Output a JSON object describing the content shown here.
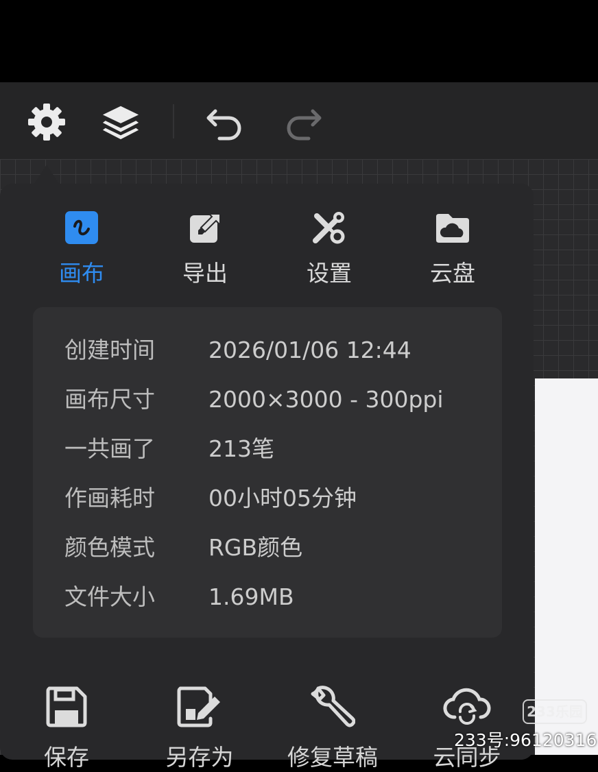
{
  "toolbar": {
    "settings_icon": "gear-icon",
    "layers_icon": "layers-icon",
    "undo_icon": "undo-icon",
    "redo_icon": "redo-icon"
  },
  "tabs": [
    {
      "label": "画布",
      "icon": "canvas-icon",
      "active": true
    },
    {
      "label": "导出",
      "icon": "export-icon",
      "active": false
    },
    {
      "label": "设置",
      "icon": "tools-icon",
      "active": false
    },
    {
      "label": "云盘",
      "icon": "cloud-drive-icon",
      "active": false
    }
  ],
  "info": [
    {
      "key": "创建时间",
      "value": "2026/01/06 12:44"
    },
    {
      "key": "画布尺寸",
      "value": "2000×3000 - 300ppi"
    },
    {
      "key": "一共画了",
      "value": "213笔"
    },
    {
      "key": "作画耗时",
      "value": "00小时05分钟"
    },
    {
      "key": "颜色模式",
      "value": "RGB颜色"
    },
    {
      "key": "文件大小",
      "value": "1.69MB"
    }
  ],
  "actions": [
    {
      "label": "保存",
      "icon": "save-icon"
    },
    {
      "label": "另存为",
      "icon": "save-as-icon"
    },
    {
      "label": "修复草稿",
      "icon": "wrench-icon"
    },
    {
      "label": "云同步",
      "icon": "cloud-sync-icon"
    }
  ],
  "watermark": {
    "logo": "233乐园",
    "id": "233号:96120316"
  },
  "colors": {
    "accent": "#2f8cf0",
    "panel": "#28282a",
    "background": "#252526"
  }
}
